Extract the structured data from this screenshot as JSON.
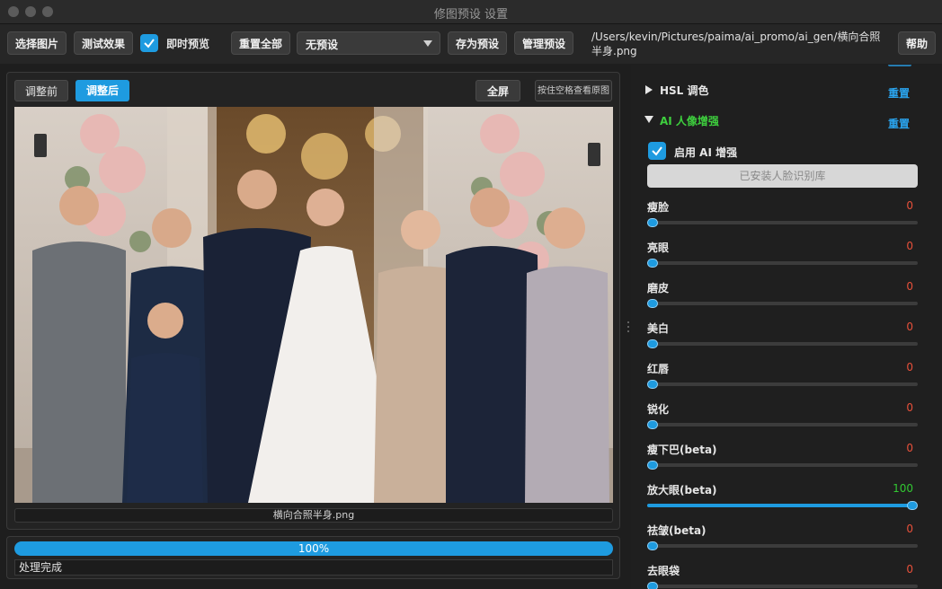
{
  "window": {
    "title": "修图预设 设置"
  },
  "toolbar": {
    "select_image": "选择图片",
    "test_effect": "测试效果",
    "live_preview_label": "即时预览",
    "live_preview_checked": true,
    "reset_all": "重置全部",
    "preset_value": "无预设",
    "save_preset": "存为预设",
    "manage_presets": "管理预设",
    "file_path": "/Users/kevin/Pictures/paima/ai_promo/ai_gen/横向合照半身.png",
    "help": "帮助"
  },
  "preview": {
    "before_tab": "调整前",
    "after_tab": "调整后",
    "fullscreen": "全屏",
    "hold_space": "按住空格查看原图",
    "file_caption": "横向合照半身.png"
  },
  "progress": {
    "percent_label": "100%",
    "value": 1.0,
    "status": "处理完成"
  },
  "panel": {
    "hsl": {
      "title": "HSL 调色",
      "expanded": false,
      "reset": "重置"
    },
    "ai": {
      "title": "AI 人像增强",
      "expanded": true,
      "reset": "重置",
      "enable_label": "启用 AI 增强",
      "enable_checked": true,
      "face_lib_button": "已安装人脸识别库",
      "sliders": [
        {
          "label": "瘦脸",
          "value": "0",
          "fraction": 0
        },
        {
          "label": "亮眼",
          "value": "0",
          "fraction": 0
        },
        {
          "label": "磨皮",
          "value": "0",
          "fraction": 0
        },
        {
          "label": "美白",
          "value": "0",
          "fraction": 0
        },
        {
          "label": "红唇",
          "value": "0",
          "fraction": 0
        },
        {
          "label": "锐化",
          "value": "0",
          "fraction": 0
        },
        {
          "label": "瘦下巴(beta)",
          "value": "0",
          "fraction": 0
        },
        {
          "label": "放大眼(beta)",
          "value": "100",
          "fraction": 1
        },
        {
          "label": "祛皱(beta)",
          "value": "0",
          "fraction": 0
        },
        {
          "label": "去眼袋",
          "value": "0",
          "fraction": 0
        }
      ]
    }
  },
  "colors": {
    "accent": "#1e9be0",
    "value_zero": "#e8503a",
    "value_active": "#32c832",
    "section_active": "#3ecf3e"
  }
}
